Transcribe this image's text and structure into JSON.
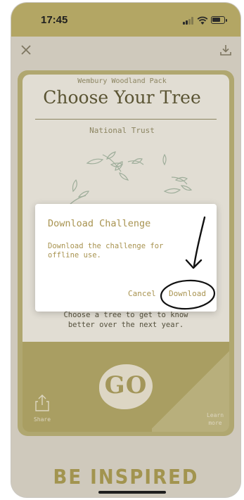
{
  "status_bar": {
    "time": "17:45"
  },
  "header": {
    "close_icon": "close-icon",
    "download_icon": "download-icon"
  },
  "card": {
    "pack_title": "Wembury Woodland Pack",
    "title": "Choose Your Tree",
    "organisation": "National Trust",
    "description": "Choose a tree to get to know better over the next year."
  },
  "actions": {
    "go_label": "GO",
    "share_label": "Share",
    "learn_more_label": "Learn more"
  },
  "footer": {
    "banner": "BE INSPIRED"
  },
  "dialog": {
    "title": "Download Challenge",
    "message": "Download the challenge for offline use.",
    "cancel_label": "Cancel",
    "download_label": "Download"
  },
  "colors": {
    "accent": "#a89350",
    "status_bar": "#b3a664",
    "card_band": "#a99e62"
  }
}
